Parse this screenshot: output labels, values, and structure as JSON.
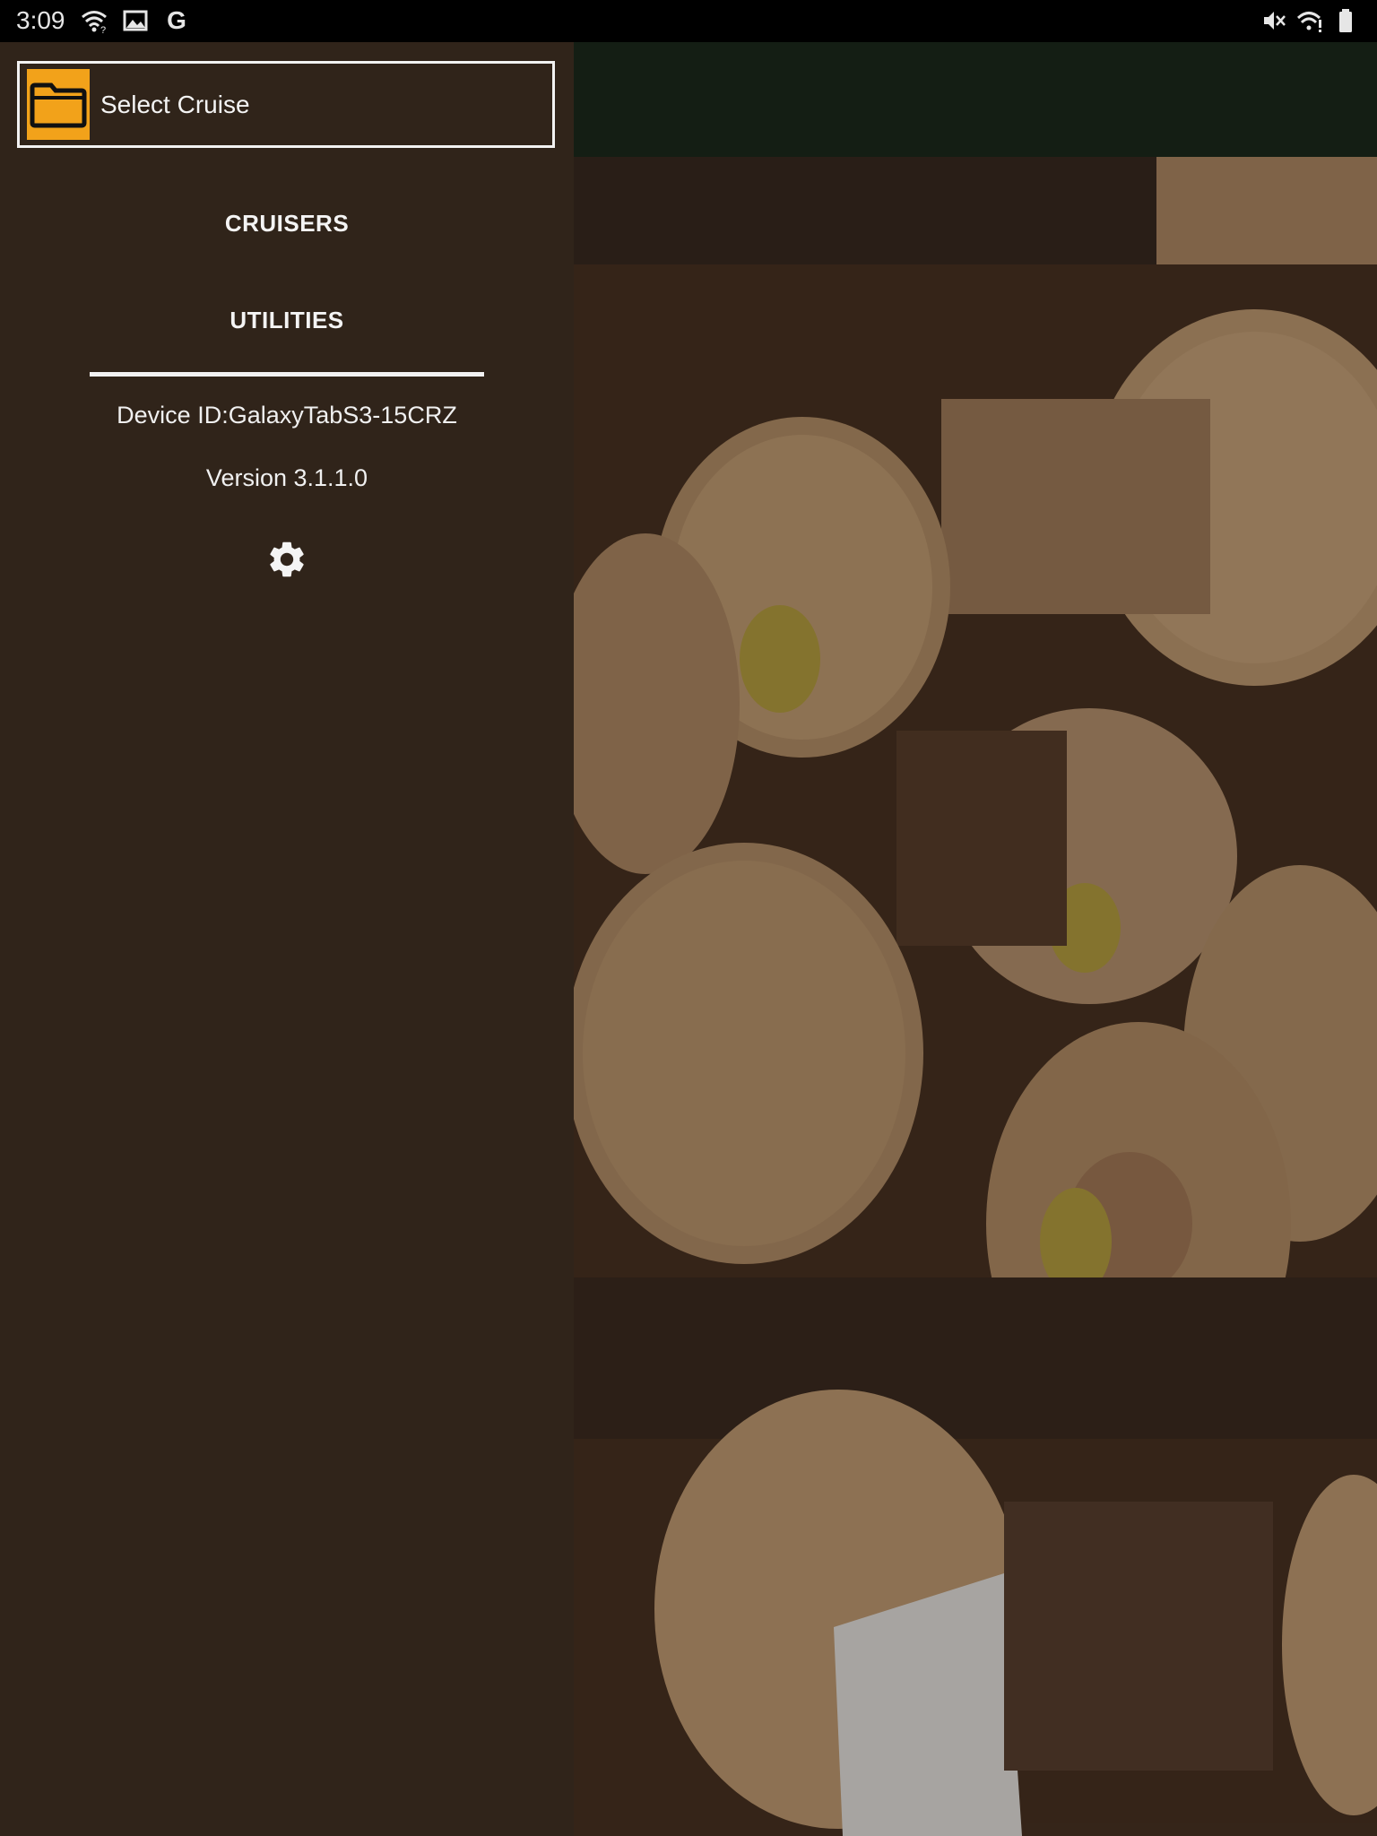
{
  "status_bar": {
    "time": "3:09",
    "left_icons": [
      "wifi-question-icon",
      "image-icon",
      "google-icon"
    ],
    "google_glyph": "G",
    "right_icons": [
      "mute-icon",
      "wifi-alert-icon",
      "battery-icon"
    ]
  },
  "drawer": {
    "select_cruise": {
      "icon": "folder-icon",
      "label": "Select Cruise"
    },
    "items": [
      {
        "label": "CRUISERS"
      },
      {
        "label": "UTILITIES"
      }
    ],
    "device_id": "Device ID:GalaxyTabS3-15CRZ",
    "version": "Version 3.1.1.0",
    "settings_icon": "gear-icon"
  },
  "colors": {
    "drawer_background": "#30241a",
    "app_bar": "#1c2a1c",
    "folder_accent": "#f2a21a",
    "text": "#f4f4f4"
  }
}
